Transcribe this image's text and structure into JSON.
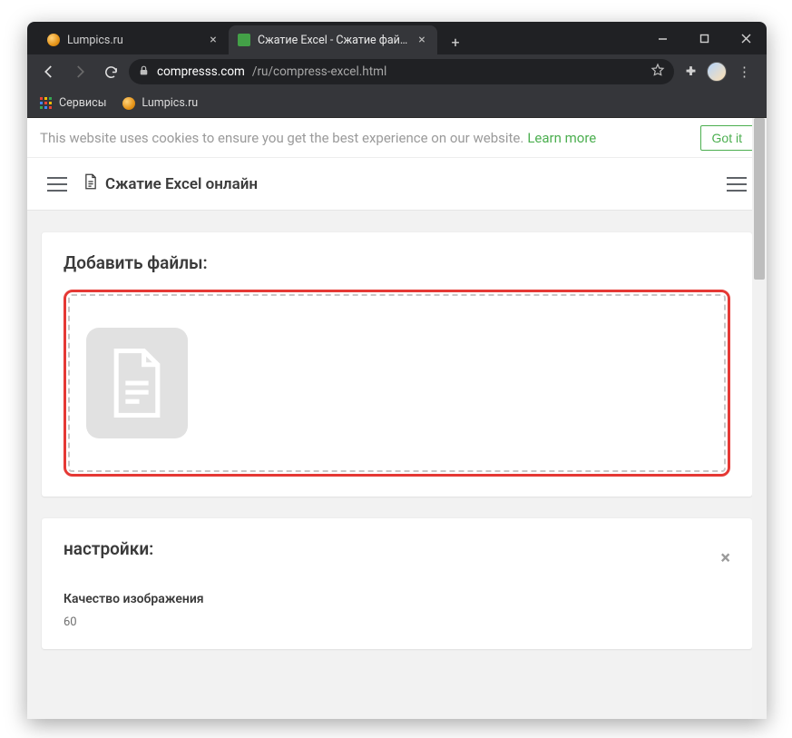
{
  "browser": {
    "tabs": [
      {
        "label": "Lumpics.ru",
        "active": false,
        "favicon": "orange"
      },
      {
        "label": "Сжатие Excel - Сжатие файлов X",
        "active": true,
        "favicon": "green"
      }
    ],
    "url_host": "compresss.com",
    "url_path": "/ru/compress-excel.html",
    "bookmarks": {
      "apps": "Сервисы",
      "lumpics": "Lumpics.ru"
    }
  },
  "cookie_banner": {
    "text": "This website uses cookies to ensure you get the best experience on our website.",
    "learn": "Learn more",
    "got_it": "Got it"
  },
  "page": {
    "title": "Сжатие Excel онлайн",
    "add_files_heading": "Добавить файлы:",
    "settings_heading": "настройки:",
    "image_quality_label": "Качество изображения",
    "image_quality_value": "60"
  },
  "scrollbar": {
    "thumb_top": 0,
    "thumb_height": 178
  }
}
